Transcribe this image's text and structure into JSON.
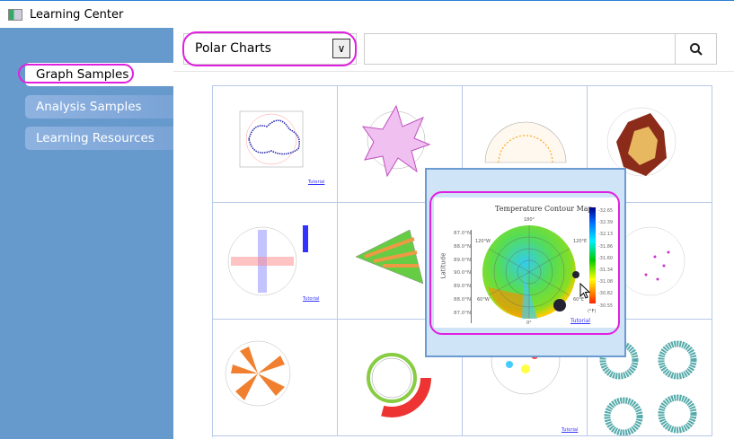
{
  "window": {
    "title": "Learning Center"
  },
  "sidebar": {
    "items": [
      {
        "label": "Graph Samples",
        "active": true
      },
      {
        "label": "Analysis Samples"
      },
      {
        "label": "Learning Resources"
      }
    ]
  },
  "toolbar": {
    "category": "Polar Charts",
    "search_value": "",
    "search_icon": "search-icon"
  },
  "thumbnails": {
    "tutorial": "Tutorial"
  },
  "popup": {
    "title": "Temperature Contour Map",
    "ylabel": "Latitude",
    "lat_ticks": [
      "87.0°N",
      "88.0°N",
      "89.0°N",
      "90.0°N",
      "89.0°N",
      "88.0°N",
      "87.0°N"
    ],
    "angles": {
      "top": "180°",
      "tl": "120°W",
      "tr": "120°E",
      "bl": "60°W",
      "br": "60°E",
      "bottom": "0°"
    },
    "scale": [
      "-32.65",
      "-32.39",
      "-32.13",
      "-31.86",
      "-31.60",
      "-31.34",
      "-31.08",
      "-30.82",
      "-30.55"
    ],
    "unit": "(°F)",
    "link": "Tutorial"
  },
  "colors": {
    "sidebar": "#6699cc",
    "highlight": "#e020e0",
    "popup_bg": "#d0e4f8"
  }
}
